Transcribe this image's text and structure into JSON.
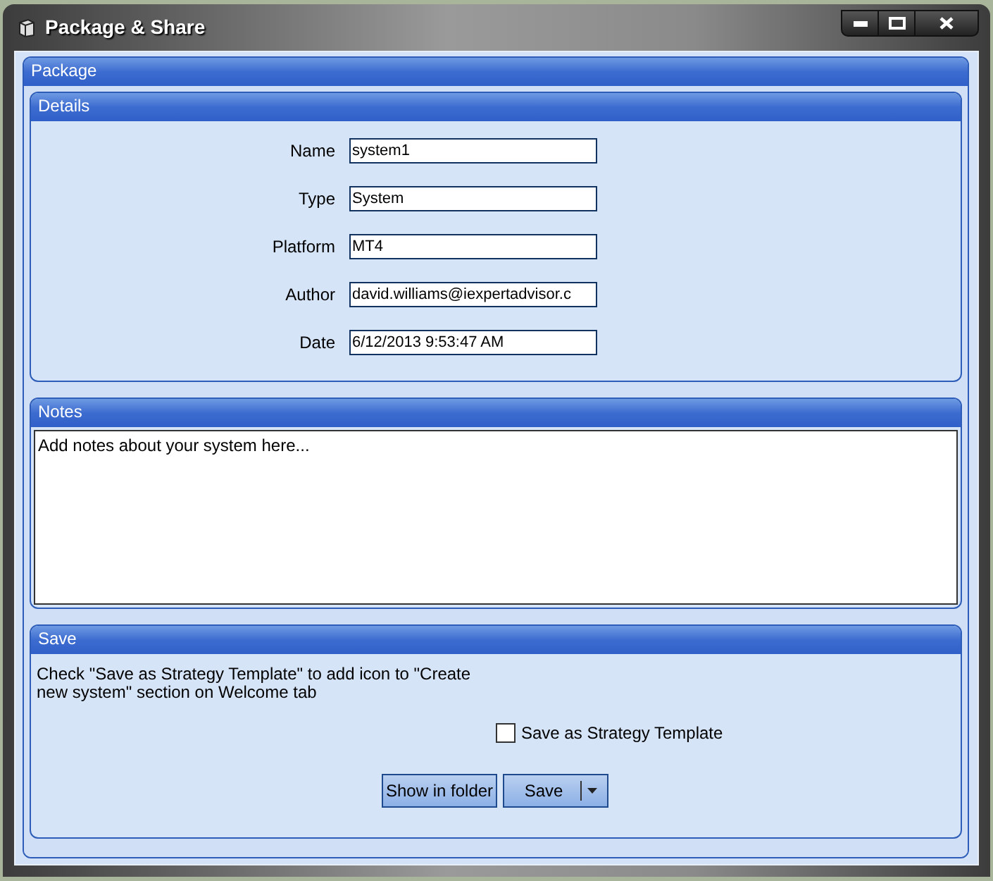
{
  "window": {
    "title": "Package & Share"
  },
  "package": {
    "title": "Package"
  },
  "details": {
    "title": "Details",
    "fields": [
      {
        "label": "Name",
        "value": "system1"
      },
      {
        "label": "Type",
        "value": "System"
      },
      {
        "label": "Platform",
        "value": "MT4"
      },
      {
        "label": "Author",
        "value": "david.williams@iexpertadvisor.c"
      },
      {
        "label": "Date",
        "value": "6/12/2013 9:53:47 AM"
      }
    ]
  },
  "notes": {
    "title": "Notes",
    "value": "Add notes about your system here..."
  },
  "save": {
    "title": "Save",
    "description": "Check \"Save as Strategy Template\" to add icon to \"Create new system\" section on Welcome tab",
    "checkbox": {
      "label": "Save as Strategy Template",
      "checked": false
    },
    "buttons": [
      {
        "kind": "plain",
        "label": "Show in folder"
      },
      {
        "kind": "split",
        "label": "Save"
      }
    ]
  }
}
